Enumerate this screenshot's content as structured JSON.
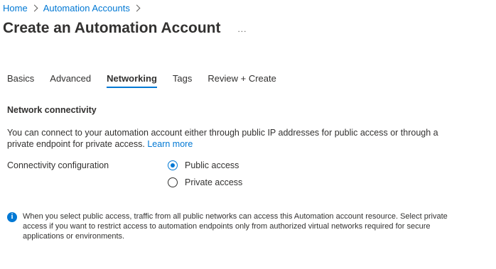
{
  "breadcrumb": {
    "items": [
      "Home",
      "Automation Accounts"
    ]
  },
  "page": {
    "title": "Create an Automation Account",
    "more_icon": "..."
  },
  "tabs": [
    {
      "label": "Basics",
      "active": false
    },
    {
      "label": "Advanced",
      "active": false
    },
    {
      "label": "Networking",
      "active": true
    },
    {
      "label": "Tags",
      "active": false
    },
    {
      "label": "Review + Create",
      "active": false
    }
  ],
  "network": {
    "section_title": "Network connectivity",
    "description": "You can connect to your automation account either through public IP addresses for public access or through a private endpoint for private access.",
    "learn_more": "Learn more",
    "config_label": "Connectivity configuration",
    "options": [
      {
        "label": "Public access",
        "selected": true
      },
      {
        "label": "Private access",
        "selected": false
      }
    ]
  },
  "info": {
    "icon": "info-icon",
    "text": "When you select public access, traffic from all public networks can access this Automation account resource. Select private access if you want to restrict access to automation endpoints only from authorized virtual networks required for secure applications or environments."
  },
  "colors": {
    "accent": "#0078d4",
    "text": "#323130"
  }
}
